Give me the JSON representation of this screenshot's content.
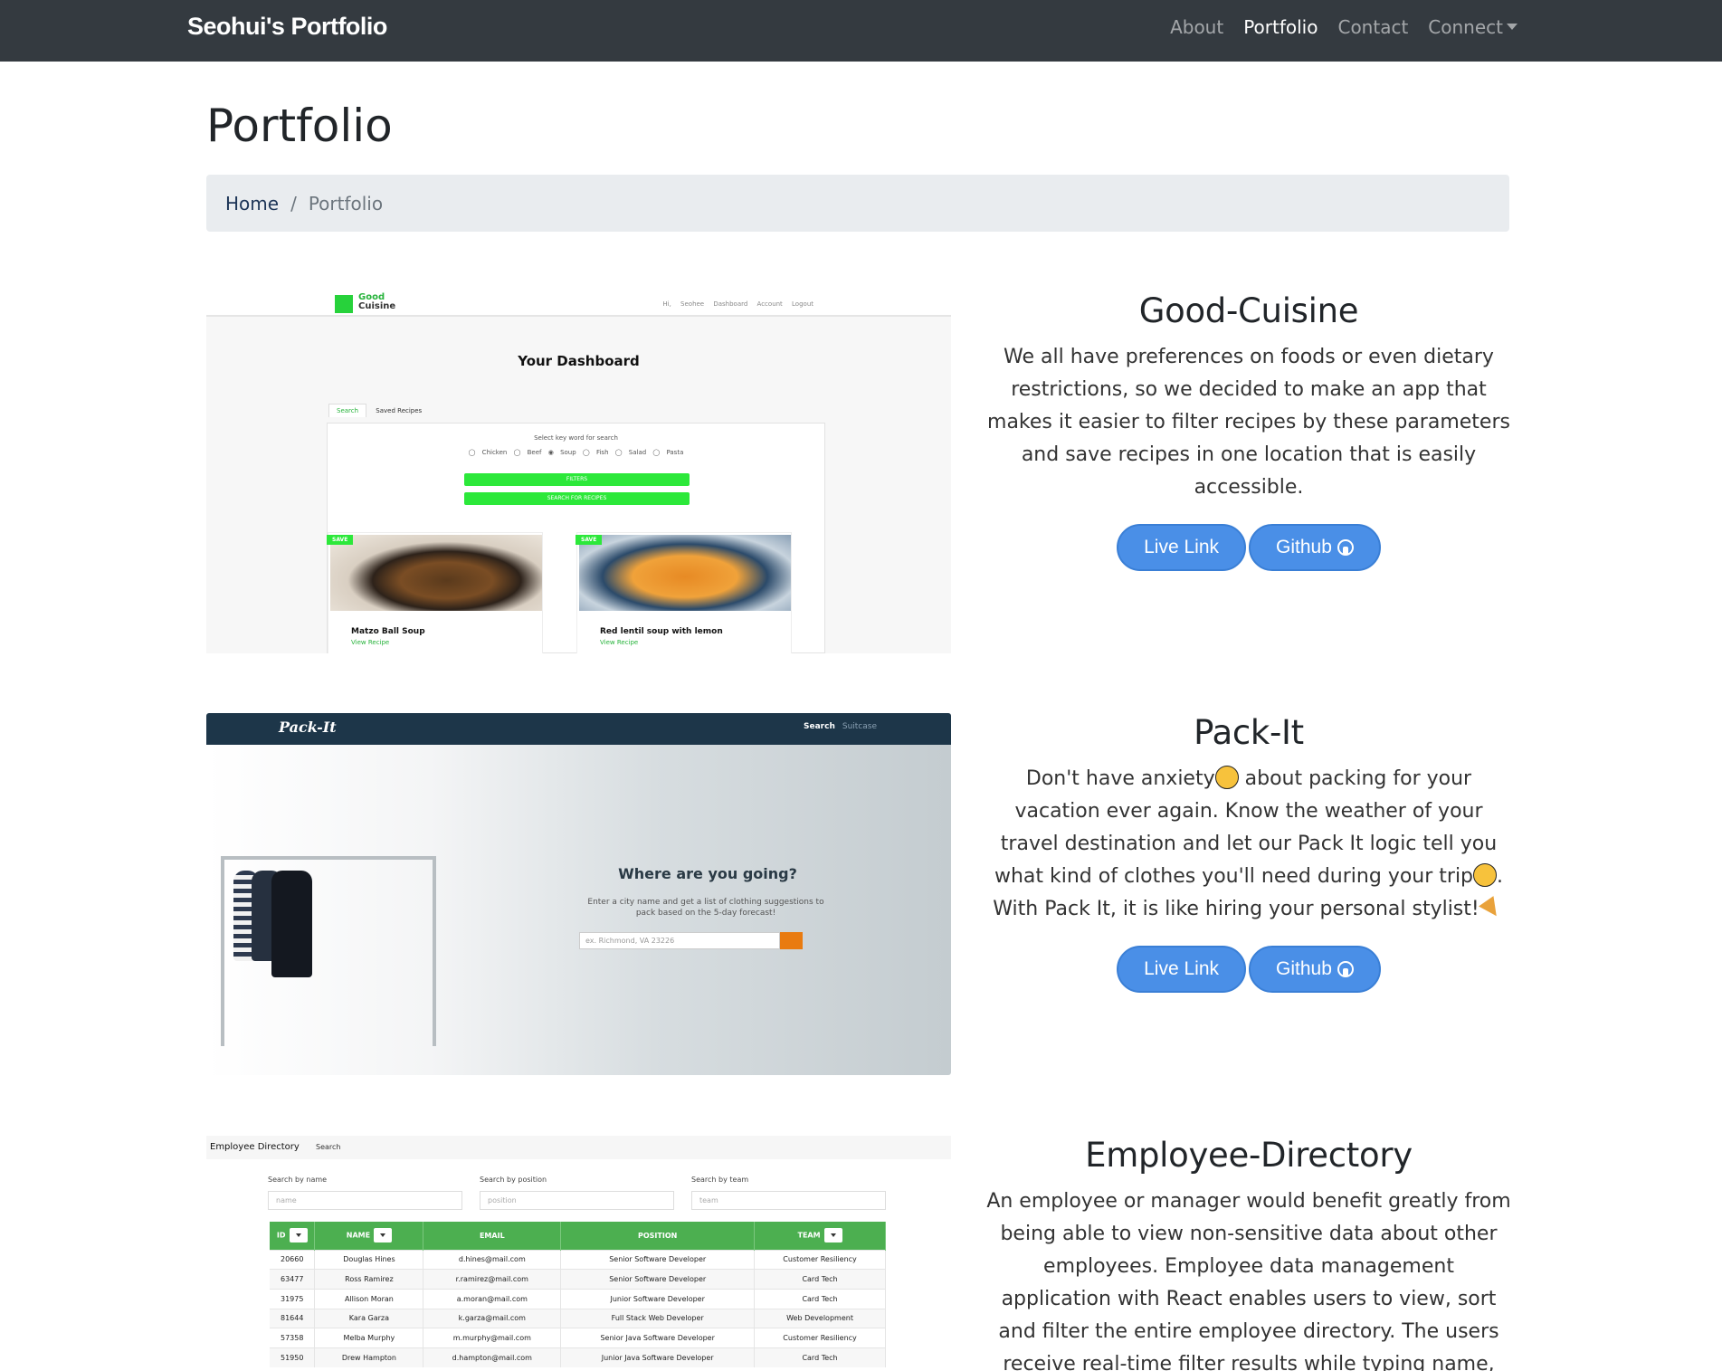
{
  "navbar": {
    "brand": "Seohui's Portfolio",
    "links": [
      "About",
      "Portfolio",
      "Contact",
      "Connect"
    ]
  },
  "page": {
    "title": "Portfolio",
    "breadcrumb": {
      "home": "Home",
      "separator": "/",
      "current": "Portfolio"
    }
  },
  "buttons": {
    "live": "Live Link",
    "github": "Github"
  },
  "projects": [
    {
      "title": "Good-Cuisine",
      "description": "We all have preferences on foods or even dietary restrictions, so we decided to make an app that makes it easier to filter recipes by these parameters and save recipes in one location that is easily accessible."
    },
    {
      "title": "Pack-It",
      "desc_parts": [
        "Don't have anxiety",
        " about packing for your vacation ever again. Know the weather of your travel destination and let our Pack It logic tell you what kind of clothes you'll need during your trip",
        ". With Pack It, it is like hiring your personal stylist!"
      ]
    },
    {
      "title": "Employee-Directory",
      "description": "An employee or manager would benefit greatly from being able to view non-sensitive data about other employees. Employee data management application with React enables users to view, sort and filter the entire employee directory. The users receive real-time filter results while typing name, position or team."
    }
  ],
  "good_cuisine_shot": {
    "logo_top": "Good",
    "logo_bottom": "Cuisine",
    "nav": "Hi, Seohee Dashboard Account Logout",
    "heading": "Your Dashboard",
    "tab_active": "Search",
    "tab_other": "Saved Recipes",
    "select_label": "Select key word for search",
    "radios": "◯ Chicken ◯ Beef ◉ Soup ◯ Fish ◯ Salad ◯ Pasta",
    "filter_btn": "FILTERS",
    "search_btn": "SEARCH FOR RECIPES",
    "save": "SAVE",
    "recipes": [
      {
        "name": "Matzo Ball Soup",
        "link": "View Recipe"
      },
      {
        "name": "Red lentil soup with lemon",
        "link": "View Recipe"
      }
    ]
  },
  "pack_it_shot": {
    "logo": "Pack-It",
    "nav_search": "Search",
    "nav_suitcase": "Suitcase",
    "question": "Where are you going?",
    "subtitle": "Enter a city name and get a list of clothing suggestions to pack based on the 5-day forecast!",
    "placeholder": "ex. Richmond, VA 23226"
  },
  "employee_shot": {
    "brand": "Employee Directory",
    "search_link": "Search",
    "labels": [
      "Search by name",
      "Search by position",
      "Search by team"
    ],
    "placeholders": [
      "name",
      "position",
      "team"
    ],
    "columns": [
      "ID",
      "NAME",
      "EMAIL",
      "POSITION",
      "TEAM"
    ],
    "rows": [
      [
        "20660",
        "Douglas Hines",
        "d.hines@mail.com",
        "Senior Software Developer",
        "Customer Resiliency"
      ],
      [
        "63477",
        "Ross Ramirez",
        "r.ramirez@mail.com",
        "Senior Software Developer",
        "Card Tech"
      ],
      [
        "31975",
        "Allison Moran",
        "a.moran@mail.com",
        "Junior Software Developer",
        "Card Tech"
      ],
      [
        "81644",
        "Kara Garza",
        "k.garza@mail.com",
        "Full Stack Web Developer",
        "Web Development"
      ],
      [
        "57358",
        "Melba Murphy",
        "m.murphy@mail.com",
        "Senior Java Software Developer",
        "Customer Resiliency"
      ],
      [
        "51950",
        "Drew Hampton",
        "d.hampton@mail.com",
        "Junior Java Software Developer",
        "Card Tech"
      ]
    ]
  }
}
